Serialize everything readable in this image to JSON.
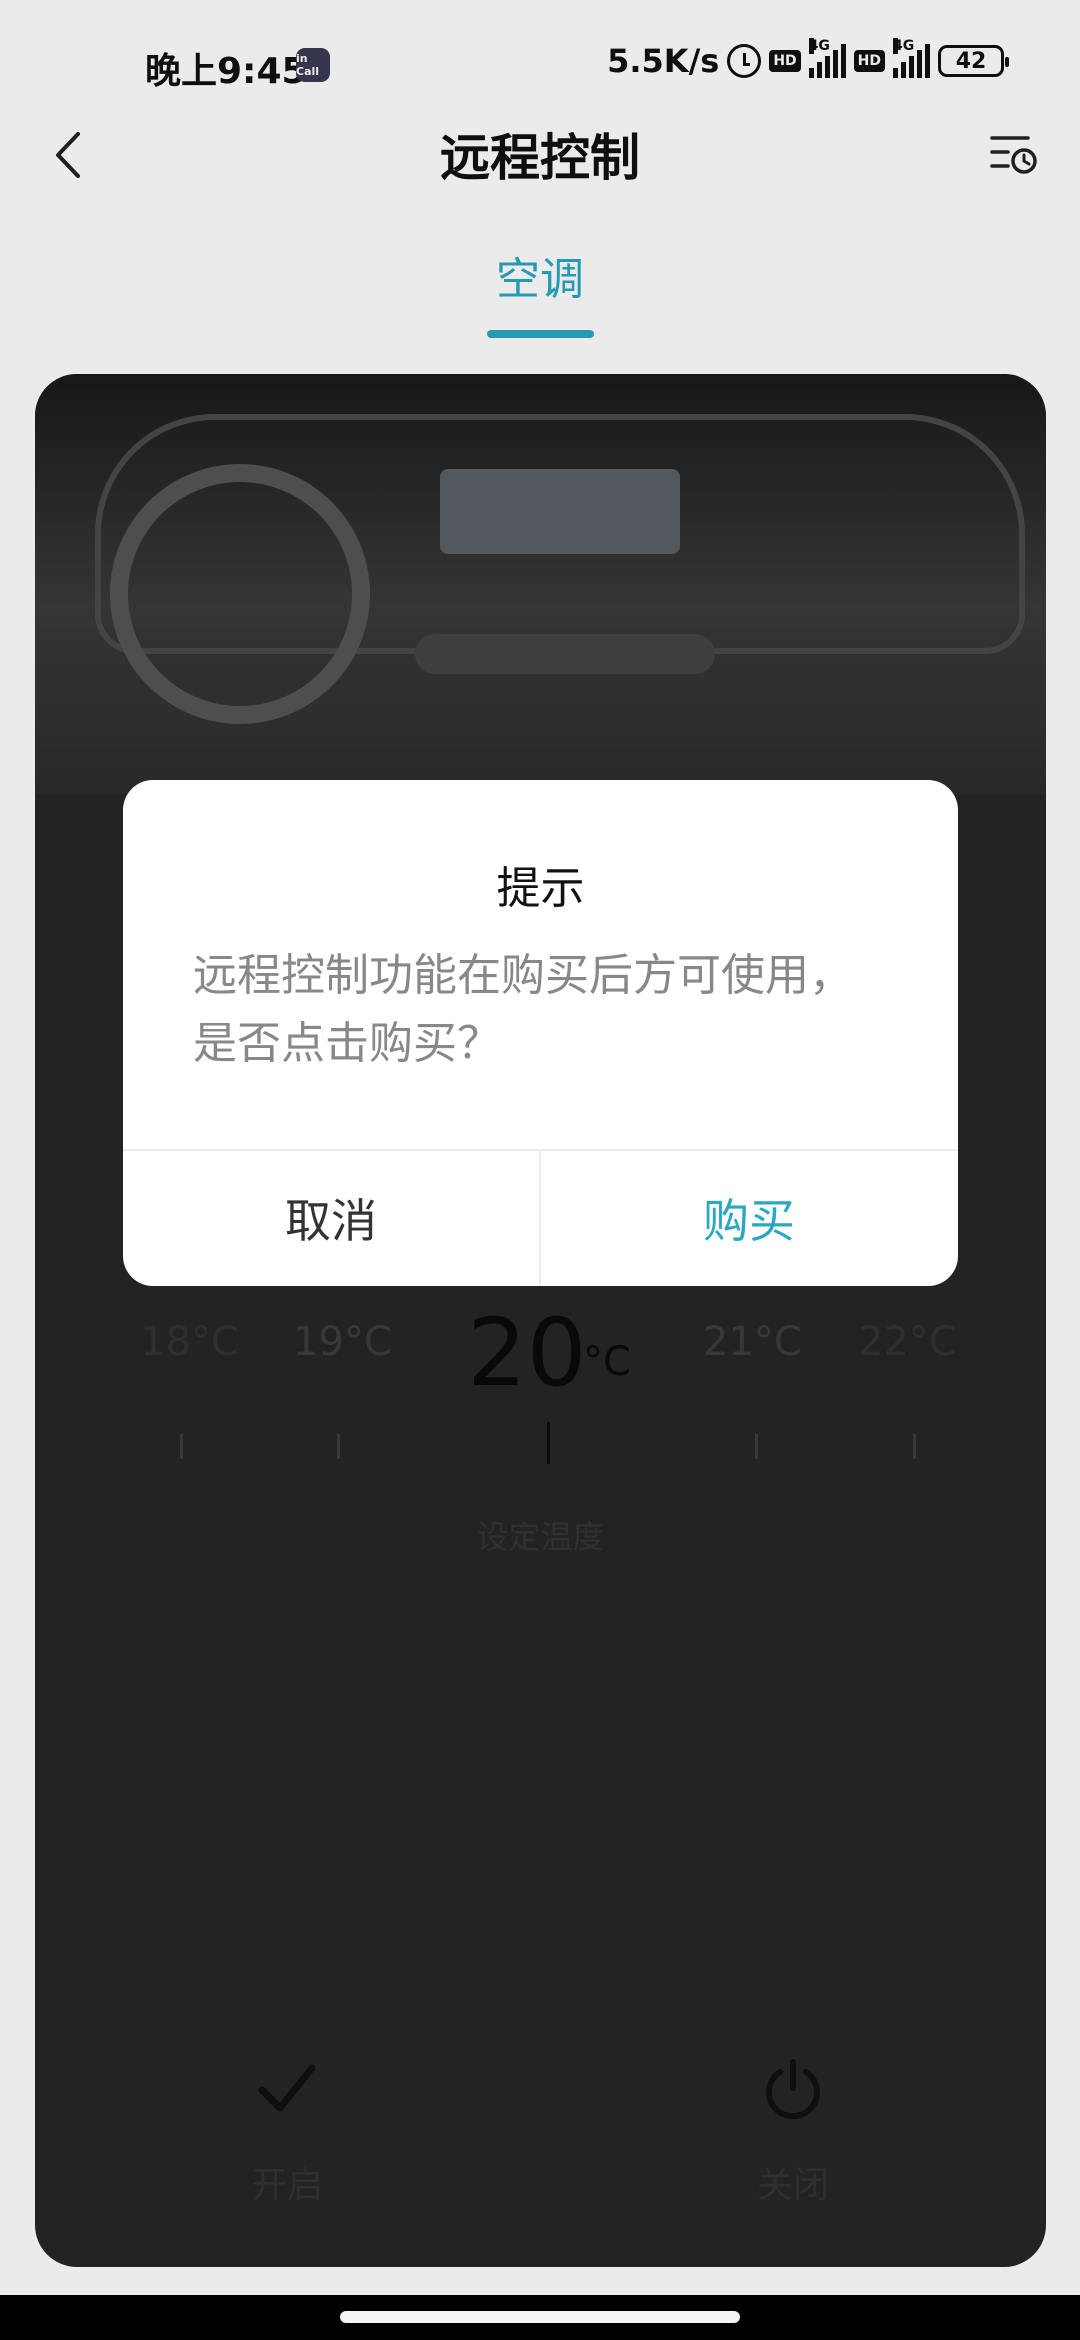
{
  "status_bar": {
    "time": "晚上9:45",
    "app_badge": "in Call",
    "speed": "5.5K/s",
    "hd1": "HD",
    "net1": "4G",
    "hd2": "HD",
    "net2": "4G",
    "battery": "42"
  },
  "header": {
    "title": "远程控制",
    "back_icon": "chevron-left-icon",
    "history_icon": "schedule-list-icon"
  },
  "tabs": [
    {
      "label": "空调",
      "active": true
    }
  ],
  "climate": {
    "temps": {
      "t18": "18°C",
      "t19": "19°C",
      "current": "20",
      "unit": "°C",
      "t21": "21°C",
      "t22": "22°C"
    },
    "set_label": "设定温度",
    "controls": {
      "on_label": "开启",
      "off_label": "关闭"
    }
  },
  "dialog": {
    "title": "提示",
    "message": "远程控制功能在购买后方可使用，是否点击购买？",
    "cancel": "取消",
    "buy": "购买"
  },
  "colors": {
    "accent": "#2aa8c2",
    "card_bg": "#262626"
  }
}
